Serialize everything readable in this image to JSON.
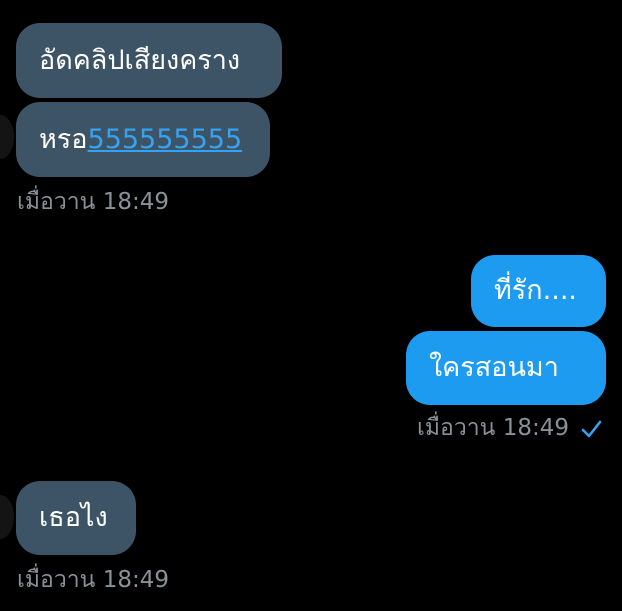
{
  "messages": {
    "incoming_group_1": {
      "bubble_1_text": "อัดคลิปเสียงคราง",
      "bubble_2_text": "หรอ",
      "bubble_2_link": "555555555",
      "timestamp": "เมื่อวาน 18:49"
    },
    "outgoing_group_1": {
      "bubble_1_text": "ที่รัก....",
      "bubble_2_text": "ใครสอนมา",
      "timestamp": "เมื่อวาน 18:49",
      "status_icon": "check-icon"
    },
    "incoming_group_2": {
      "bubble_1_text": "เธอไง",
      "timestamp": "เมื่อวาน 18:49"
    }
  },
  "colors": {
    "background": "#000000",
    "incoming_bubble": "#3d5466",
    "outgoing_bubble": "#1d9bf0",
    "link": "#35a3f2",
    "timestamp": "#8a9199"
  }
}
